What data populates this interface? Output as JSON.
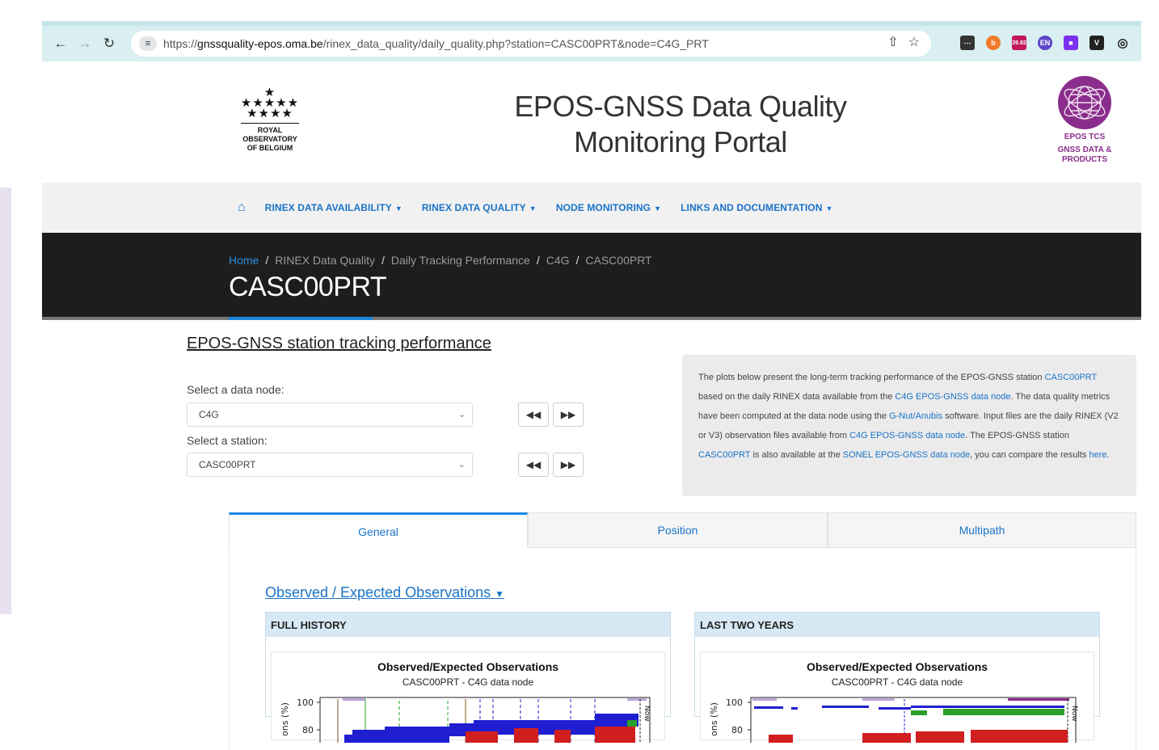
{
  "browser": {
    "url_scheme": "https://",
    "url_host": "gnssquality-epos.oma.be",
    "url_path": "/rinex_data_quality/daily_quality.php?station=CASC00PRT&node=C4G_PRT",
    "extension_badge": "39.82"
  },
  "header": {
    "rob_line1": "ROYAL OBSERVATORY",
    "rob_line2": "OF BELGIUM",
    "title_line1": "EPOS-GNSS Data Quality",
    "title_line2": "Monitoring Portal",
    "epos_line1": "EPOS TCS",
    "epos_line2": "GNSS DATA & PRODUCTS"
  },
  "nav": {
    "items": [
      {
        "label": "RINEX DATA AVAILABILITY"
      },
      {
        "label": "RINEX DATA QUALITY"
      },
      {
        "label": "NODE MONITORING"
      },
      {
        "label": "LINKS AND DOCUMENTATION"
      }
    ]
  },
  "breadcrumb": {
    "home": "Home",
    "c1": "RINEX Data Quality",
    "c2": "Daily Tracking Performance",
    "c3": "C4G",
    "c4": "CASC00PRT",
    "sep": "/"
  },
  "page": {
    "title": "CASC00PRT",
    "section_title": "EPOS-GNSS station tracking performance",
    "node_label": "Select a data node:",
    "node_value": "C4G",
    "station_label": "Select a station:",
    "station_value": "CASC00PRT"
  },
  "info": {
    "t1": "The plots below present the long-term tracking performance of the EPOS-GNSS station ",
    "l1": "CASC00PRT",
    "t2": " based on the daily RINEX data available from the ",
    "l2": "C4G EPOS-GNSS data node",
    "t3": ". The data quality metrics have been computed at the data node using the ",
    "l3": "G-Nut/Anubis",
    "t4": " software. Input files are the daily RINEX (V2 or V3) observation files available from ",
    "l4": "C4G EPOS-GNSS data node",
    "t5": ". The EPOS-GNSS station ",
    "l5": "CASC00PRT",
    "t6": " is also available at the ",
    "l6": "SONEL EPOS-GNSS data node",
    "t7": ", you can compare the results ",
    "l7": "here",
    "t8": "."
  },
  "tabs": [
    {
      "label": "General",
      "active": true
    },
    {
      "label": "Position",
      "active": false
    },
    {
      "label": "Multipath",
      "active": false
    }
  ],
  "content": {
    "obs_link": "Observed / Expected Observations",
    "panels": [
      {
        "head": "FULL HISTORY",
        "plot_title": "Observed/Expected Observations",
        "plot_sub": "CASC00PRT - C4G data node",
        "y_ticks": [
          "100",
          "80"
        ],
        "ylabel": "ons (%)",
        "now_label": "Now"
      },
      {
        "head": "LAST TWO YEARS",
        "plot_title": "Observed/Expected Observations",
        "plot_sub": "CASC00PRT - C4G data node",
        "y_ticks": [
          "100",
          "80"
        ],
        "ylabel": "ons (%)",
        "now_label": "Now"
      }
    ]
  },
  "colors": {
    "accent": "#1a73c8",
    "epos_purple": "#8a2d8c",
    "hero_bg": "#1d1d1d",
    "series_blue": "#1f1fd1",
    "series_red": "#d11f1f",
    "series_green": "#2aa02a"
  }
}
